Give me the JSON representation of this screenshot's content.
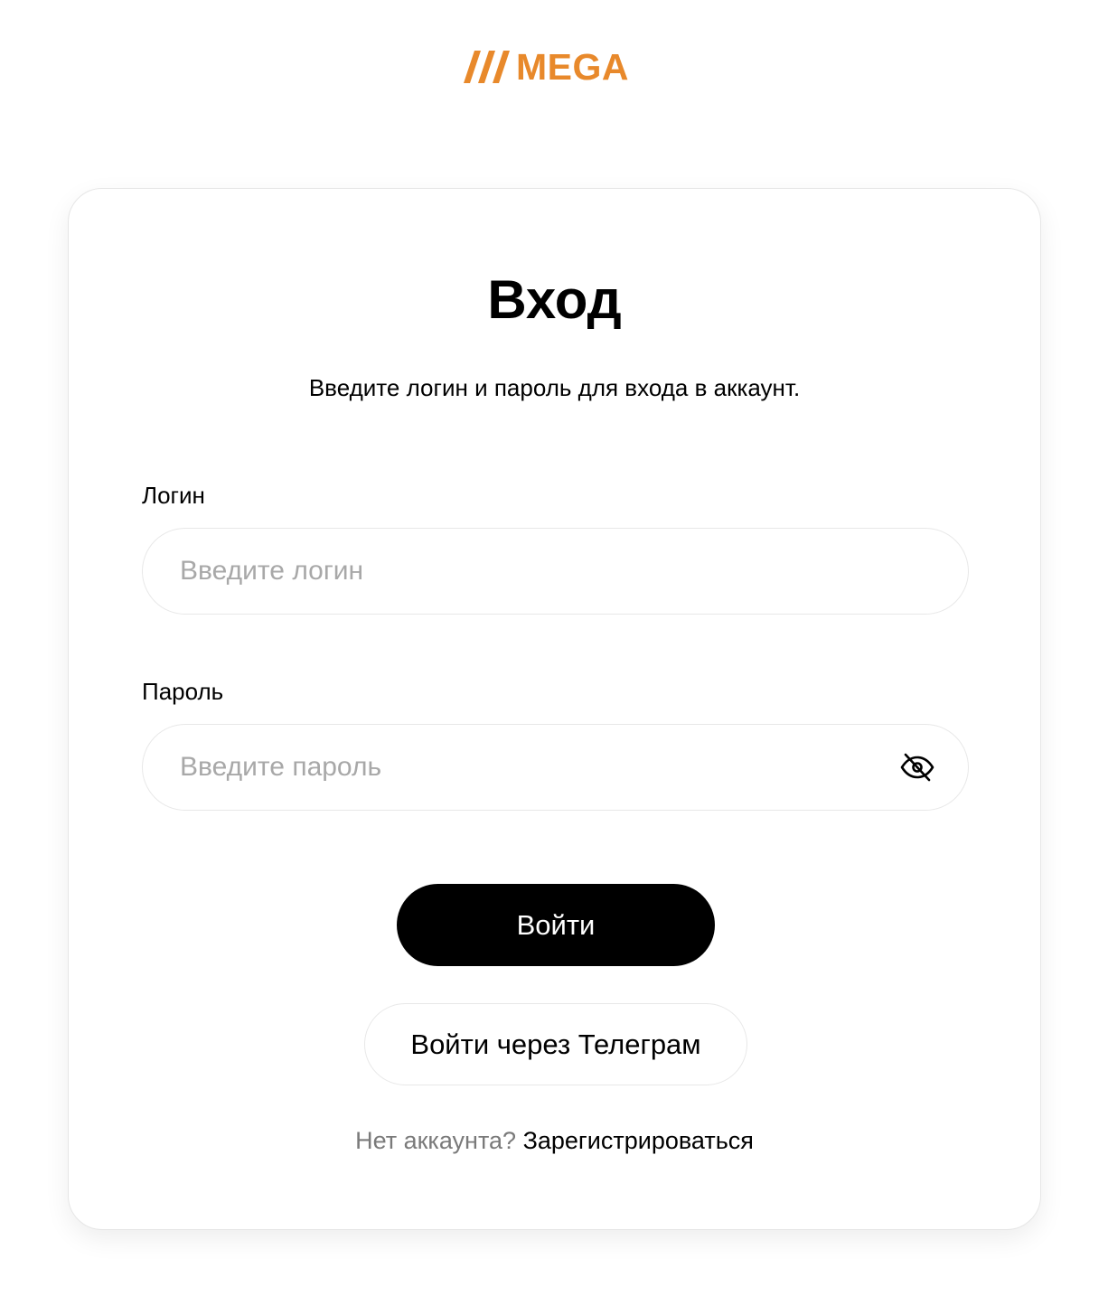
{
  "brand": {
    "name": "MEGA",
    "accent_color": "#E8892B"
  },
  "login_card": {
    "title": "Вход",
    "subtitle": "Введите логин и пароль для входа в аккаунт.",
    "login_field": {
      "label": "Логин",
      "placeholder": "Введите логин",
      "value": ""
    },
    "password_field": {
      "label": "Пароль",
      "placeholder": "Введите пароль",
      "value": "",
      "toggle_icon": "eye-off-icon"
    },
    "submit_label": "Войти",
    "telegram_label": "Войти через Телеграм",
    "register_prompt": "Нет аккаунта?",
    "register_link": "Зарегистрироваться"
  },
  "colors": {
    "primary_button_bg": "#000000",
    "primary_button_text": "#FFFFFF",
    "muted_text": "#7A7A7A",
    "placeholder_text": "#A8A8A8",
    "border": "#E8E8E8"
  }
}
